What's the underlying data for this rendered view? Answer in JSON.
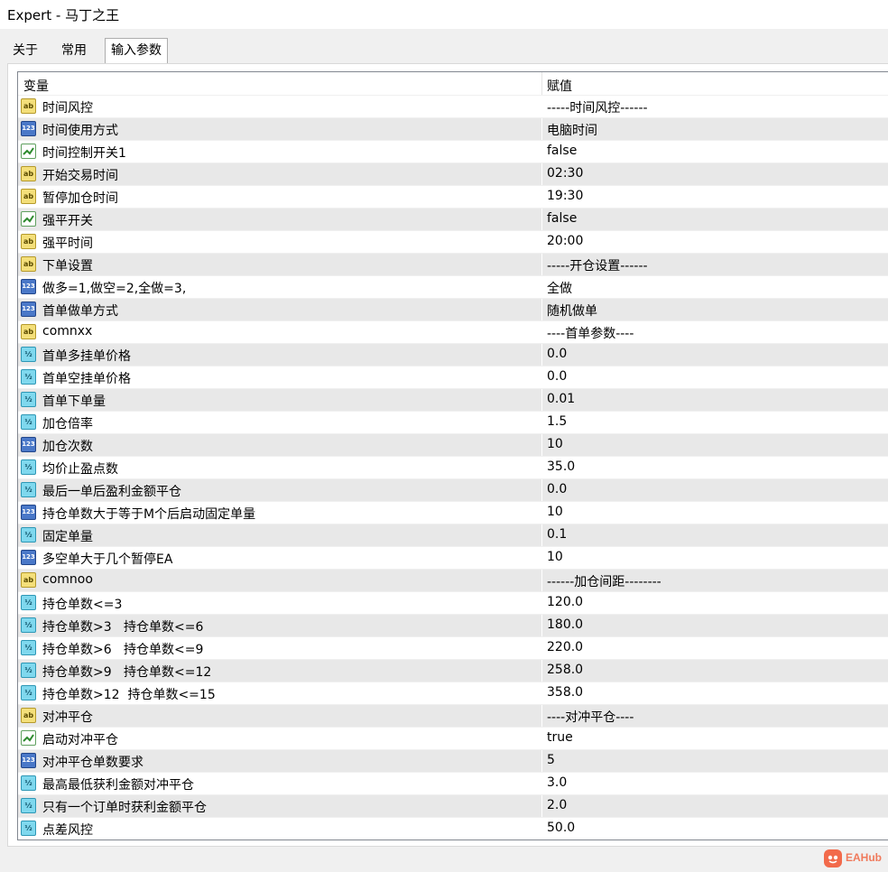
{
  "window": {
    "title": "Expert - 马丁之王"
  },
  "tabs": [
    {
      "label": "关于"
    },
    {
      "label": "常用"
    },
    {
      "label": "输入参数"
    }
  ],
  "table": {
    "headers": {
      "variable": "变量",
      "value": "赋值"
    },
    "rows": [
      {
        "type": "string",
        "icon": "ab",
        "name": "时间风控",
        "value": "-----时间风控------"
      },
      {
        "type": "integer",
        "icon": "123",
        "name": "时间使用方式",
        "value": "电脑时间"
      },
      {
        "type": "bool",
        "icon": "",
        "name": "时间控制开关1",
        "value": "false"
      },
      {
        "type": "string",
        "icon": "ab",
        "name": "开始交易时间",
        "value": "02:30"
      },
      {
        "type": "string",
        "icon": "ab",
        "name": "暂停加仓时间",
        "value": "19:30"
      },
      {
        "type": "bool",
        "icon": "",
        "name": "强平开关",
        "value": "false"
      },
      {
        "type": "string",
        "icon": "ab",
        "name": "强平时间",
        "value": "20:00"
      },
      {
        "type": "string",
        "icon": "ab",
        "name": "下单设置",
        "value": "-----开仓设置------"
      },
      {
        "type": "integer",
        "icon": "123",
        "name": "做多=1,做空=2,全做=3,",
        "value": "全做"
      },
      {
        "type": "integer",
        "icon": "123",
        "name": "首单做单方式",
        "value": "随机做单"
      },
      {
        "type": "string",
        "icon": "ab",
        "name": "comnxx",
        "value": "----首单参数----"
      },
      {
        "type": "double",
        "icon": "½",
        "name": "首单多挂单价格",
        "value": "0.0"
      },
      {
        "type": "double",
        "icon": "½",
        "name": "首单空挂单价格",
        "value": "0.0"
      },
      {
        "type": "double",
        "icon": "½",
        "name": "首单下单量",
        "value": "0.01"
      },
      {
        "type": "double",
        "icon": "½",
        "name": "加仓倍率",
        "value": "1.5"
      },
      {
        "type": "integer",
        "icon": "123",
        "name": "加仓次数",
        "value": "10"
      },
      {
        "type": "double",
        "icon": "½",
        "name": "均价止盈点数",
        "value": "35.0"
      },
      {
        "type": "double",
        "icon": "½",
        "name": "最后一单后盈利金额平仓",
        "value": "0.0"
      },
      {
        "type": "integer",
        "icon": "123",
        "name": "持仓单数大于等于M个后启动固定单量",
        "value": "10"
      },
      {
        "type": "double",
        "icon": "½",
        "name": "固定单量",
        "value": "0.1"
      },
      {
        "type": "integer",
        "icon": "123",
        "name": "多空单大于几个暂停EA",
        "value": "10"
      },
      {
        "type": "string",
        "icon": "ab",
        "name": "comnoo",
        "value": "------加仓间距--------"
      },
      {
        "type": "double",
        "icon": "½",
        "name": "持仓单数<=3",
        "value": "120.0"
      },
      {
        "type": "double",
        "icon": "½",
        "name": "持仓单数>3   持仓单数<=6",
        "value": "180.0"
      },
      {
        "type": "double",
        "icon": "½",
        "name": "持仓单数>6   持仓单数<=9",
        "value": "220.0"
      },
      {
        "type": "double",
        "icon": "½",
        "name": "持仓单数>9   持仓单数<=12",
        "value": "258.0"
      },
      {
        "type": "double",
        "icon": "½",
        "name": "持仓单数>12  持仓单数<=15",
        "value": "358.0"
      },
      {
        "type": "string",
        "icon": "ab",
        "name": "对冲平仓",
        "value": "----对冲平仓----"
      },
      {
        "type": "bool",
        "icon": "",
        "name": "启动对冲平仓",
        "value": "true"
      },
      {
        "type": "integer",
        "icon": "123",
        "name": "对冲平仓单数要求",
        "value": "5"
      },
      {
        "type": "double",
        "icon": "½",
        "name": "最高最低获利金额对冲平仓",
        "value": "3.0"
      },
      {
        "type": "double",
        "icon": "½",
        "name": "只有一个订单时获利金额平仓",
        "value": "2.0"
      },
      {
        "type": "double",
        "icon": "½",
        "name": "点差风控",
        "value": "50.0"
      }
    ]
  },
  "watermark": {
    "text": "EAHub"
  }
}
